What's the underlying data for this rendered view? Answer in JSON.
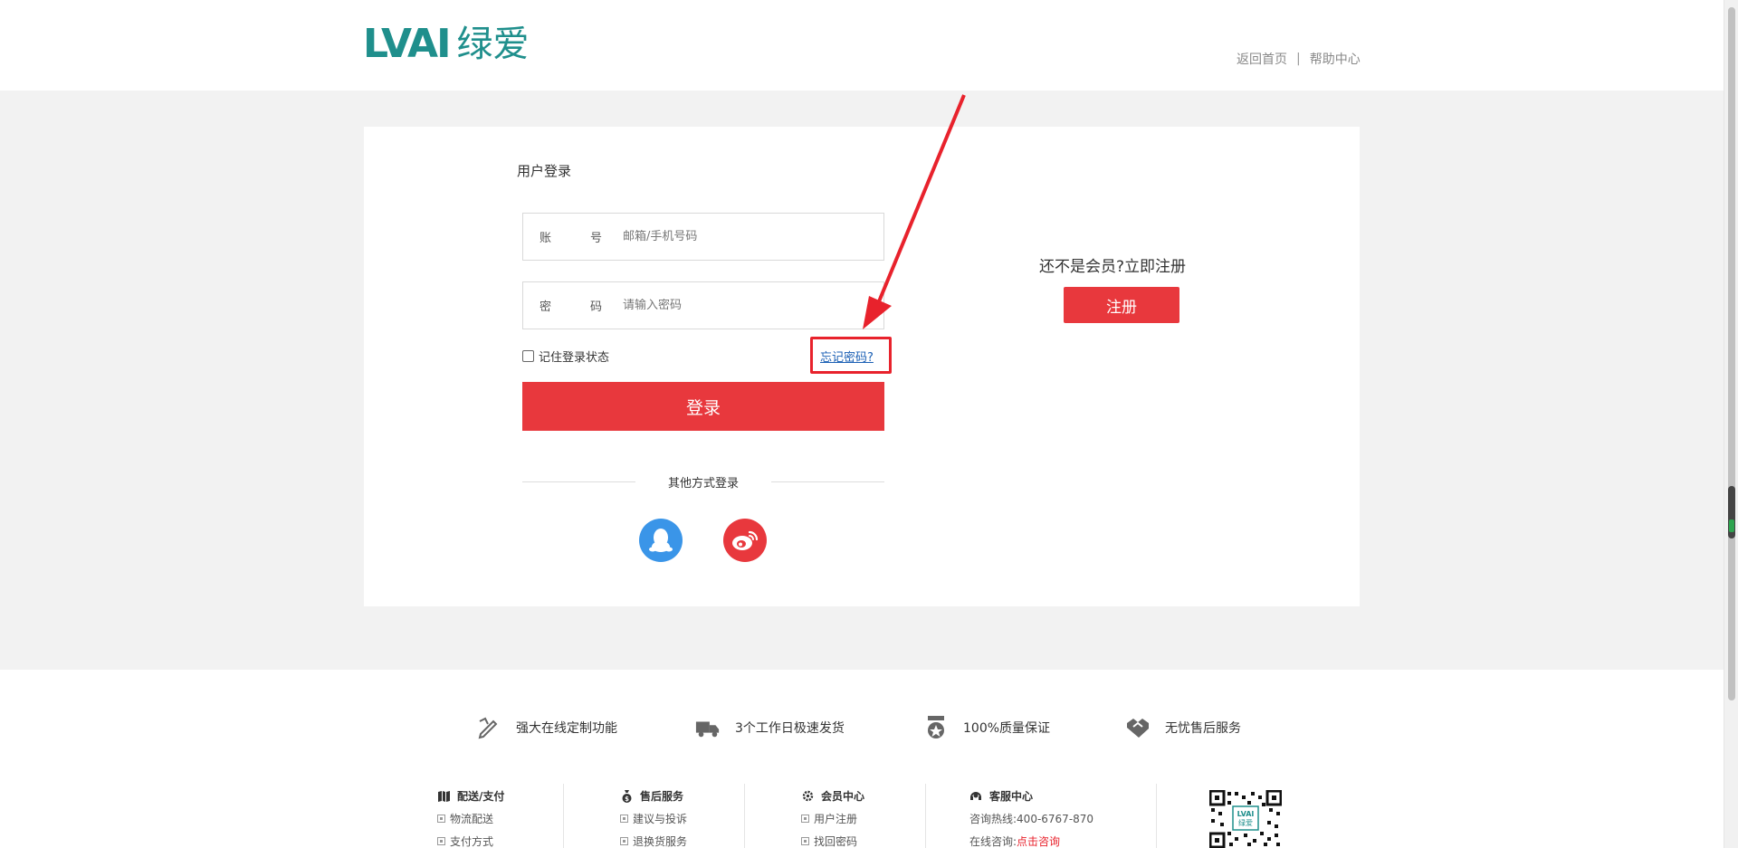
{
  "header": {
    "logo_latin": "LVAI",
    "logo_cn": "绿爱",
    "home_link": "返回首页",
    "separator": "|",
    "help_link": "帮助中心"
  },
  "login": {
    "title": "用户登录",
    "account_label_1": "账",
    "account_label_2": "号",
    "account_placeholder": "邮箱/手机号码",
    "password_label_1": "密",
    "password_label_2": "码",
    "password_placeholder": "请输入密码",
    "remember_label": "记住登录状态",
    "forgot_link": "忘记密码?",
    "submit_label": "登录",
    "other_methods": "其他方式登录"
  },
  "register": {
    "prompt": "还不是会员?立即注册",
    "button_label": "注册"
  },
  "colors": {
    "brand_teal": "#1f8f8c",
    "accent_red": "#e8383d",
    "annotation_red": "#e8222c",
    "qq_blue": "#3a95e8"
  },
  "features": [
    {
      "icon": "pencil-ruler-icon",
      "label": "强大在线定制功能"
    },
    {
      "icon": "delivery-truck-icon",
      "label": "3个工作日极速发货"
    },
    {
      "icon": "quality-medal-icon",
      "label": "100%质量保证"
    },
    {
      "icon": "handshake-icon",
      "label": "无忧售后服务"
    }
  ],
  "footer_columns": [
    {
      "icon": "map-icon",
      "title": "配送/支付",
      "items": [
        "物流配送",
        "支付方式"
      ]
    },
    {
      "icon": "money-bag-icon",
      "title": "售后服务",
      "items": [
        "建议与投诉",
        "退换货服务"
      ]
    },
    {
      "icon": "gear-icon",
      "title": "会员中心",
      "items": [
        "用户注册",
        "找回密码"
      ]
    }
  ],
  "service": {
    "icon": "headset-icon",
    "title": "客服中心",
    "hotline_label": "咨询热线:",
    "hotline": "400-6767-870",
    "online_label": "在线咨询:",
    "online_link": "点击咨询"
  },
  "qr": {
    "icon": "qr-code-icon",
    "logo_text_1": "LVAI",
    "logo_text_2": "绿爱"
  }
}
